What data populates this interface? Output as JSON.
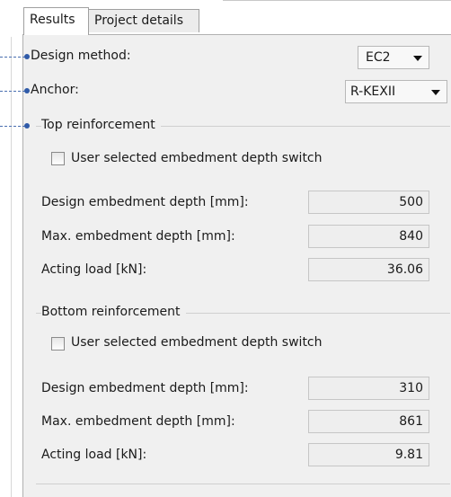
{
  "tabs": [
    {
      "label": "Results",
      "active": true
    },
    {
      "label": "Project details",
      "active": false
    }
  ],
  "design_method": {
    "label": "Design method:",
    "value": "EC2"
  },
  "anchor": {
    "label": "Anchor:",
    "value": "R-KEXII"
  },
  "top_reinforcement": {
    "title": "Top reinforcement",
    "switch_label": "User selected embedment depth switch",
    "switch_checked": false,
    "fields": [
      {
        "label": "Design embedment depth [mm]:",
        "value": "500"
      },
      {
        "label": "Max. embedment depth [mm]:",
        "value": "840"
      },
      {
        "label": "Acting load [kN]:",
        "value": "36.06"
      }
    ]
  },
  "bottom_reinforcement": {
    "title": "Bottom reinforcement",
    "switch_label": "User selected embedment depth switch",
    "switch_checked": false,
    "fields": [
      {
        "label": "Design embedment depth [mm]:",
        "value": "310"
      },
      {
        "label": "Max. embedment depth [mm]:",
        "value": "861"
      },
      {
        "label": "Acting load [kN]:",
        "value": "9.81"
      }
    ]
  },
  "colors": {
    "leader": "#2f5aa8",
    "panel_bg": "#f0f0f0"
  }
}
